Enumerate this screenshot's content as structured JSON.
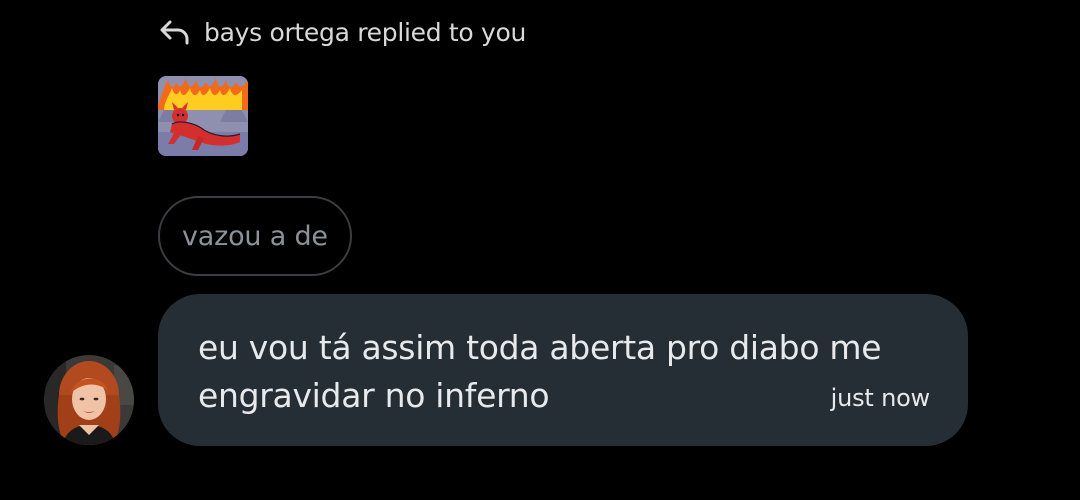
{
  "reply_header": {
    "icon": "reply-arrow-icon",
    "text": "bays ortega replied to you"
  },
  "sticker": {
    "icon": "devil-in-flames-sticker"
  },
  "quoted_message": {
    "text": "vazou a de"
  },
  "message": {
    "text": "eu vou tá assim toda aberta pro diabo me engravidar no inferno",
    "timestamp": "just now"
  },
  "sender_avatar": {
    "icon": "profile-photo-avatar"
  },
  "colors": {
    "background": "#000000",
    "bubble": "#252d35",
    "quoted_border": "#3a3d41",
    "quoted_text": "#8b9299",
    "primary_text": "#e7e9ea"
  }
}
